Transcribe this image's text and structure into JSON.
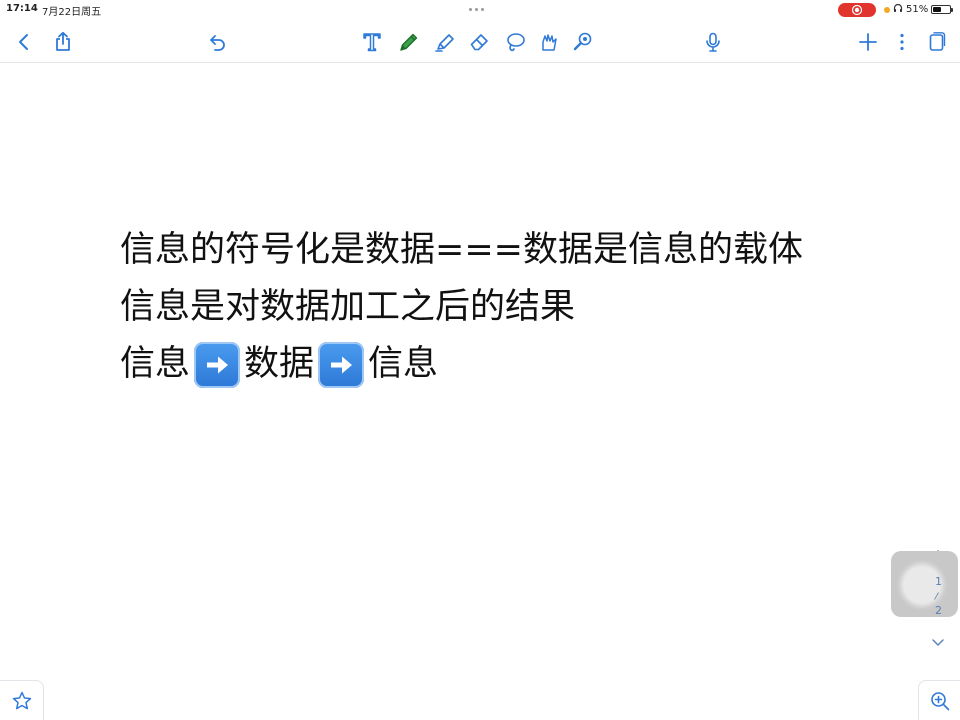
{
  "status_bar": {
    "time": "17:14",
    "date": "7月22日周五",
    "battery_percent": "51%",
    "battery_level": 0.51,
    "recording_color": "#e0342c"
  },
  "toolbar": {
    "left": [
      "back-icon",
      "share-icon",
      "undo-icon"
    ],
    "tools": [
      "text-tool-icon",
      "pen-tool-icon",
      "highlighter-tool-icon",
      "eraser-tool-icon",
      "lasso-tool-icon",
      "shape-tool-icon",
      "laser-pointer-icon"
    ],
    "right": [
      "microphone-icon",
      "add-icon",
      "more-icon",
      "pages-icon"
    ],
    "active_tool": "pen-tool-icon",
    "icon_color": "#2f7ad8",
    "active_color": "#2e8b3a"
  },
  "note": {
    "lines": [
      "信息的符号化是数据===数据是信息的载体",
      "信息是对数据加工之后的结果"
    ],
    "flow": {
      "part1": "信息",
      "part2": "数据",
      "part3": "信息",
      "separator_icon": "right-arrow-emoji"
    }
  },
  "pager": {
    "current_page": "1",
    "total_pages": "2"
  },
  "bottom": {
    "left_icon": "star-icon",
    "right_icon": "zoom-in-icon"
  }
}
